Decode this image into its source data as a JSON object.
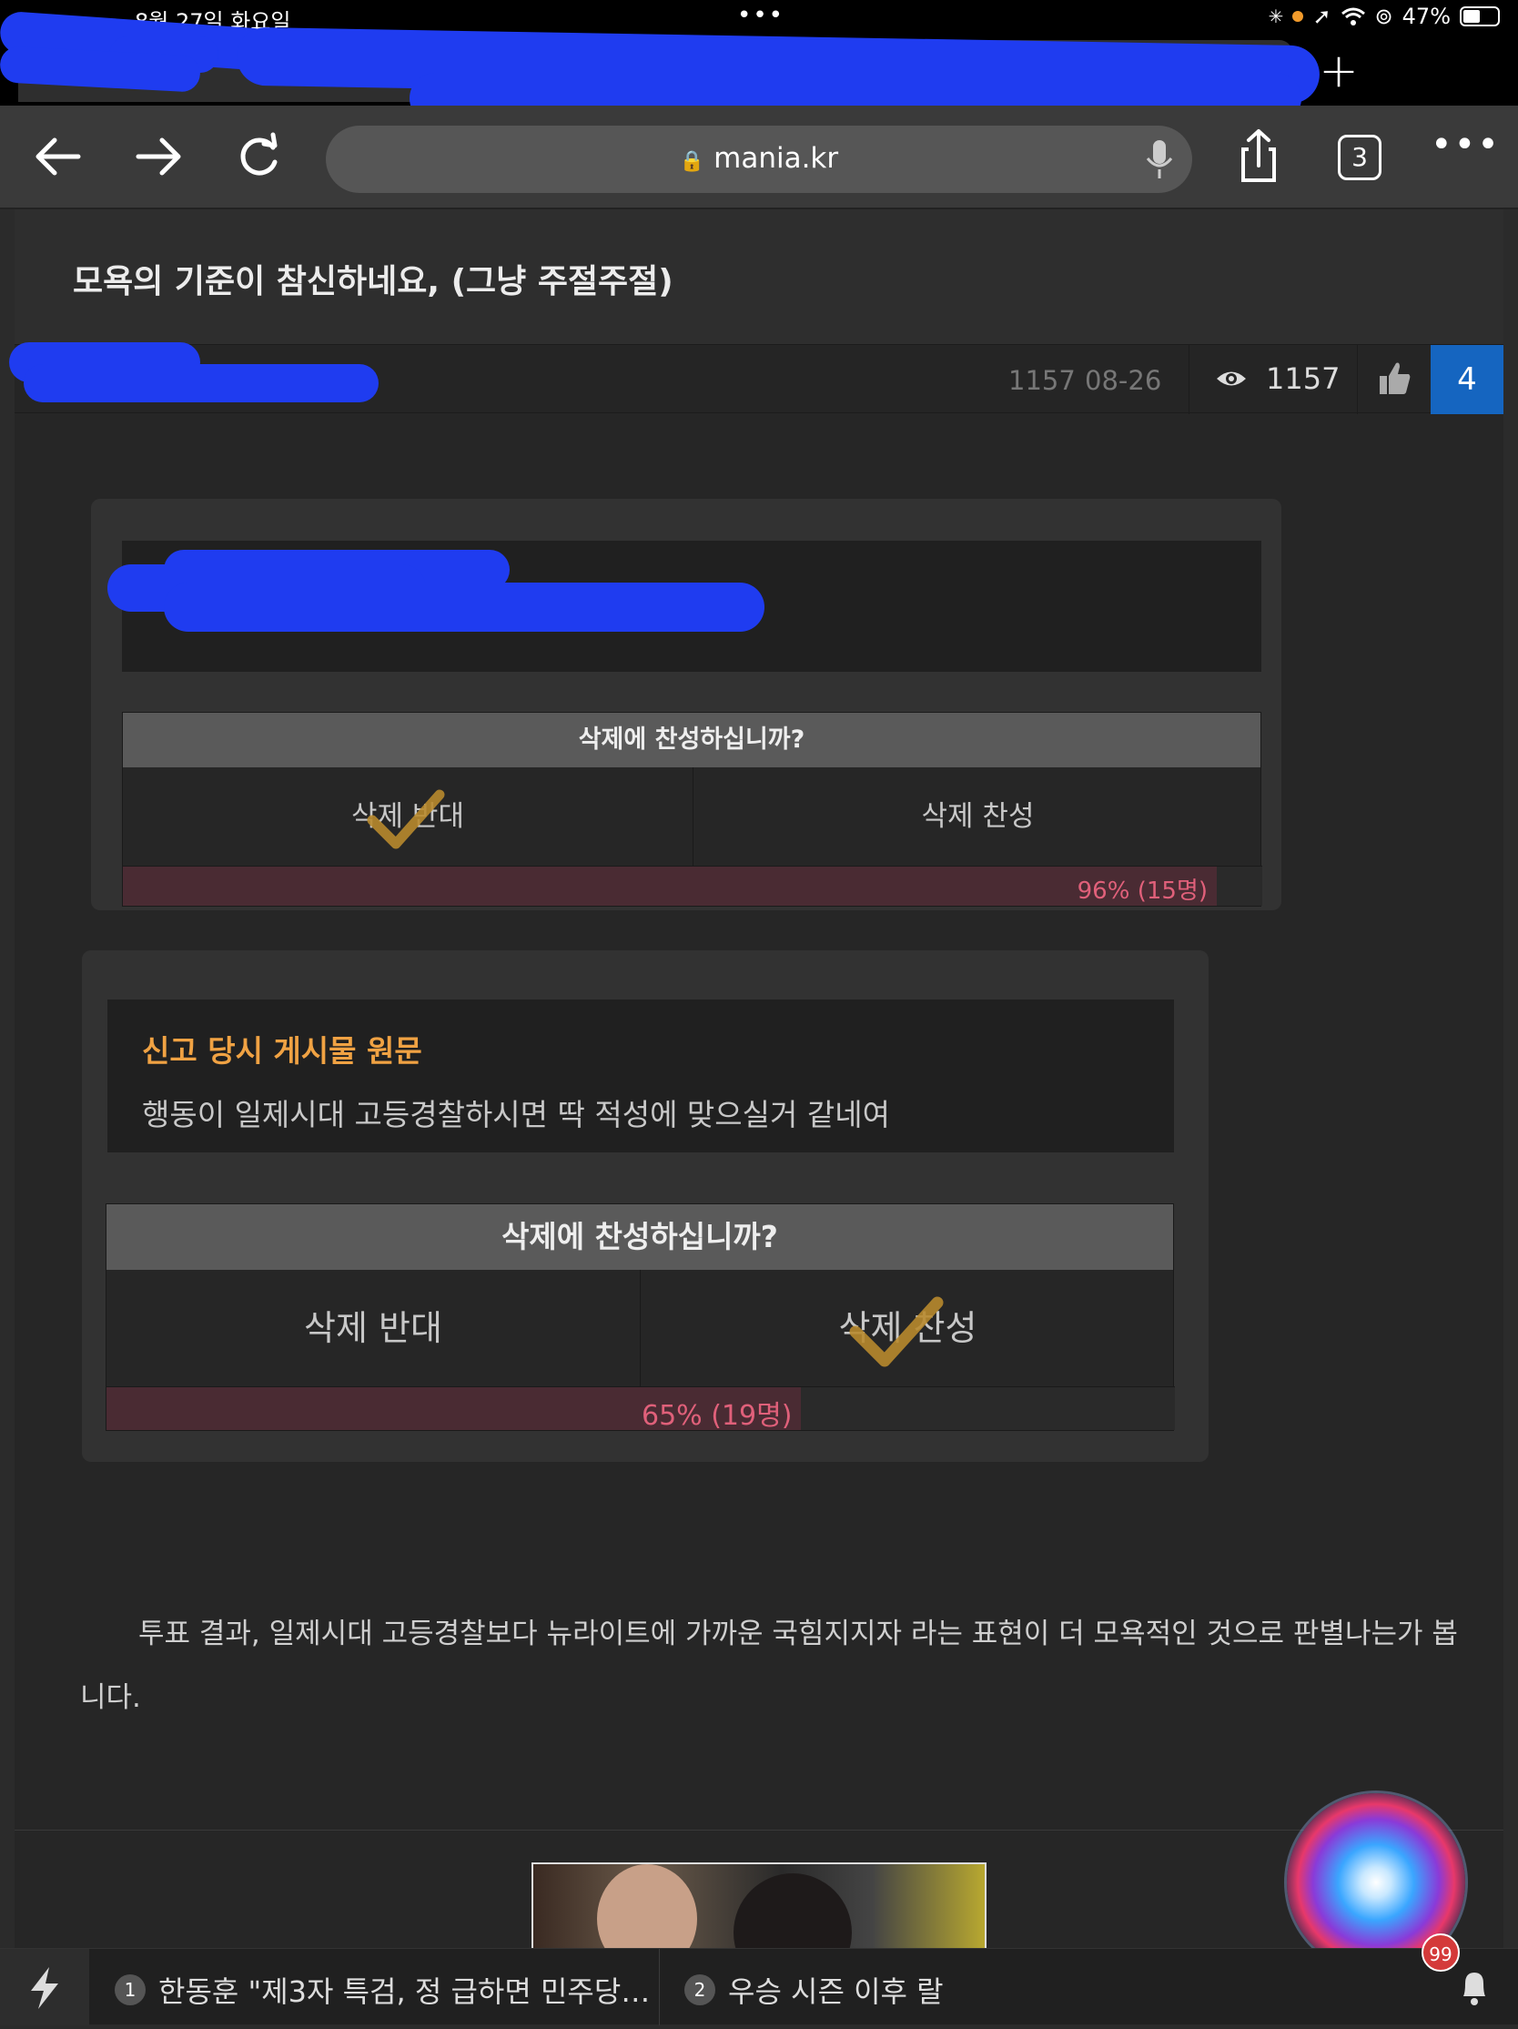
{
  "status_bar": {
    "time": "8월 27일 화요일",
    "dots": "•••",
    "battery": "47%"
  },
  "browser": {
    "url": "mania.kr",
    "tab_count": "3",
    "new_tab": "+",
    "close_tab": "✕"
  },
  "post": {
    "title": "모욕의 기준이 참신하네요, (그냥 주절주절)",
    "number": "1157",
    "date": "08-26",
    "views": "1157",
    "likes": "4"
  },
  "vote1": {
    "question": "삭제에 찬성하십니까?",
    "option_against": "삭제 반대",
    "option_for": "삭제 찬성",
    "result_label": "96% (15명)",
    "result_fraction": 0.96,
    "checked": "against"
  },
  "vote2": {
    "quote_heading": "신고 당시 게시물 원문",
    "quote_text": "행동이 일제시대 고등경찰하시면 딱 적성에 맞으실거 같네여",
    "question": "삭제에 찬성하십니까?",
    "option_against": "삭제 반대",
    "option_for": "삭제 찬성",
    "result_label": "65% (19명)",
    "result_fraction": 0.65,
    "checked": "for"
  },
  "summary": "투표 결과, 일제시대 고등경찰보다 뉴라이트에 가까운 국힘지지자 라는 표현이 더 모욕적인 것으로 판별나는가 봅니다.",
  "ticker": {
    "items": [
      {
        "num": "1",
        "text": "한동훈 \"제3자 특검, 정 급하면 민주당…"
      },
      {
        "num": "2",
        "text": "우승 시즌 이후 랄"
      }
    ],
    "badge": "99"
  },
  "colors": {
    "accent_blue": "#1565c0",
    "quote_heading": "#f0a243",
    "result_text": "#e0607a",
    "check_mark": "#b8892e"
  }
}
